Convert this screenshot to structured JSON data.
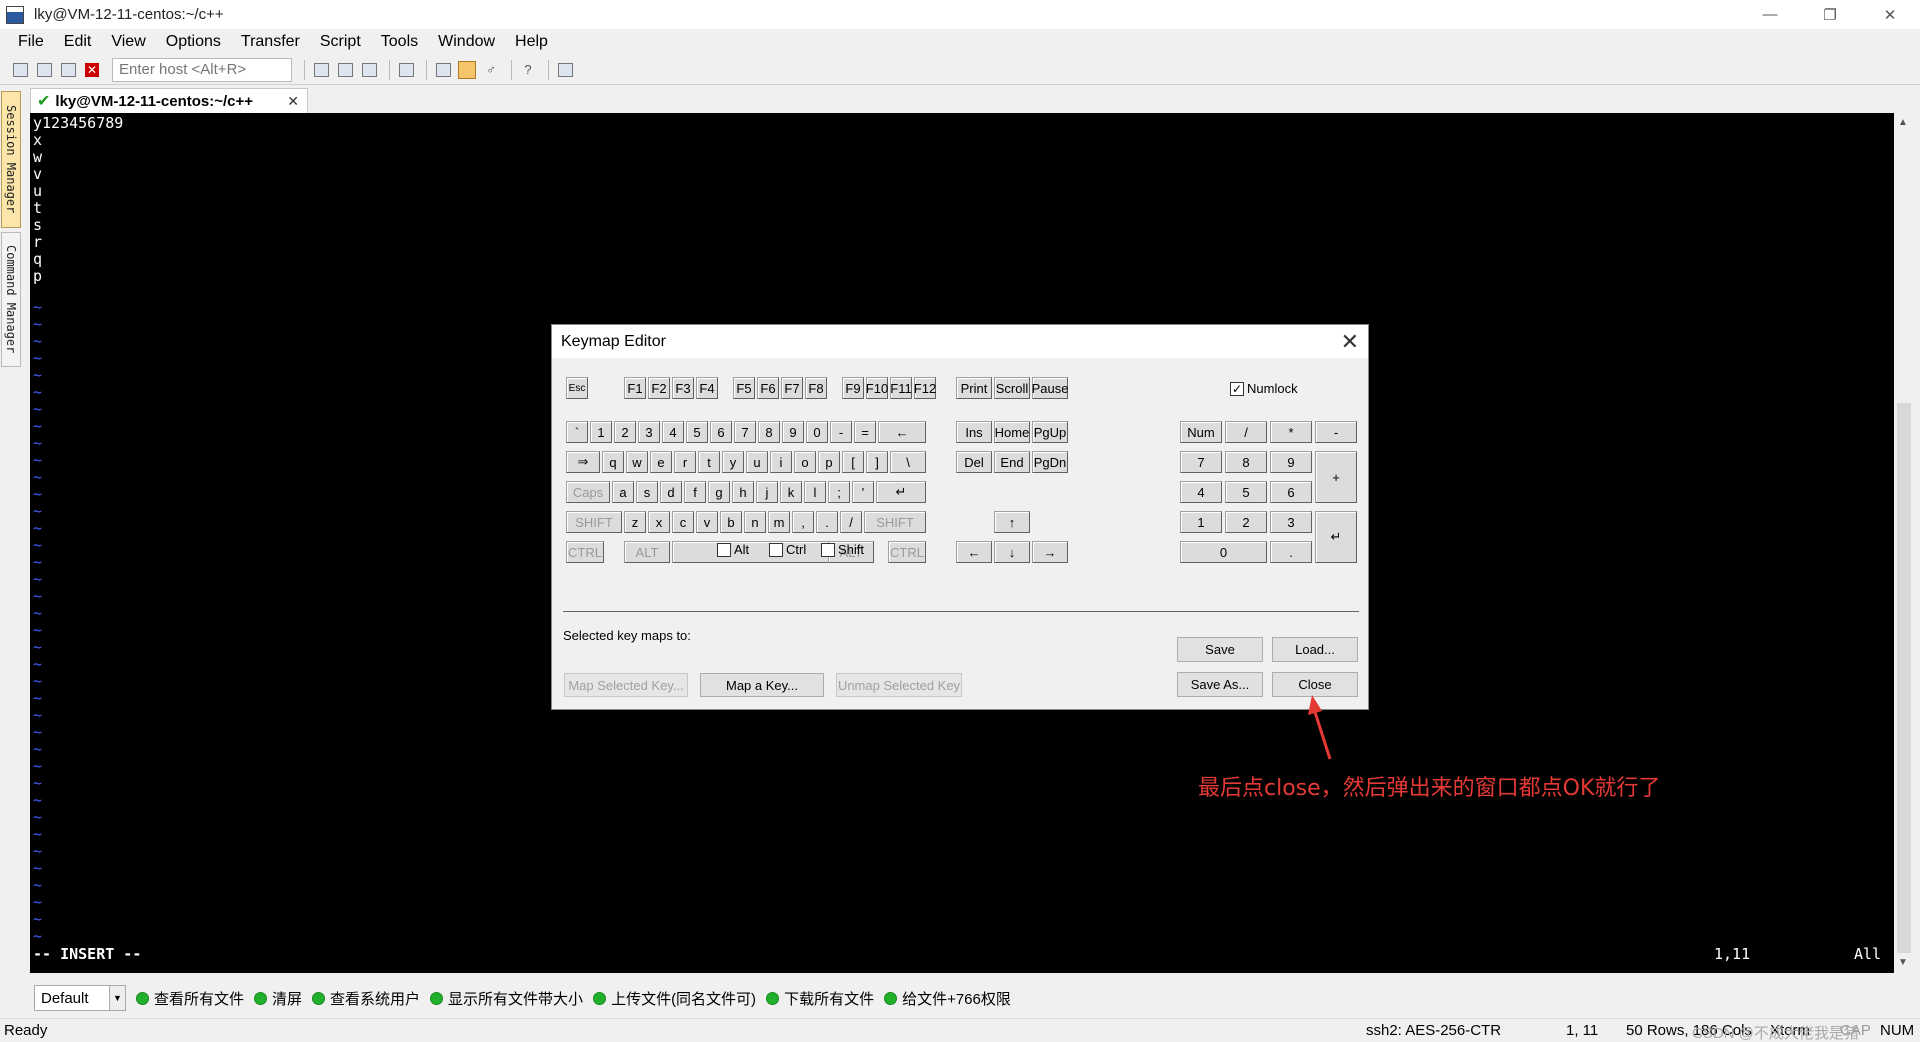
{
  "window": {
    "title": "lky@VM-12-11-centos:~/c++",
    "controls": [
      "—",
      "❐",
      "✕"
    ]
  },
  "menu": [
    "File",
    "Edit",
    "View",
    "Options",
    "Transfer",
    "Script",
    "Tools",
    "Window",
    "Help"
  ],
  "toolbar": {
    "host_placeholder": "Enter host <Alt+R>"
  },
  "side_tabs": {
    "session": "Session Manager",
    "command": "Command Manager"
  },
  "session_tab": {
    "label": "lky@VM-12-11-centos:~/c++",
    "check": "✔",
    "close": "✕"
  },
  "terminal": {
    "lines": "y123456789\nx\nw\nv\nu\nt\ns\nr\nq\np",
    "tilde": "~",
    "mode": "-- INSERT --",
    "position": "1,11",
    "all": "All"
  },
  "dialog": {
    "title": "Keymap Editor",
    "close": "✕",
    "keys": {
      "esc": "Esc",
      "f1": "F1",
      "f2": "F2",
      "f3": "F3",
      "f4": "F4",
      "f5": "F5",
      "f6": "F6",
      "f7": "F7",
      "f8": "F8",
      "f9": "F9",
      "f10": "F10",
      "f11": "F11",
      "f12": "F12",
      "print": "Print",
      "scroll": "Scroll",
      "pause": "Pause",
      "backtick": "`",
      "n1": "1",
      "n2": "2",
      "n3": "3",
      "n4": "4",
      "n5": "5",
      "n6": "6",
      "n7": "7",
      "n8": "8",
      "n9": "9",
      "n0": "0",
      "minus": "-",
      "equal": "=",
      "backspace": "←",
      "tab": "⇒",
      "q": "q",
      "w": "w",
      "e": "e",
      "r": "r",
      "t": "t",
      "y": "y",
      "u": "u",
      "i": "i",
      "o": "o",
      "p": "p",
      "lbracket": "[",
      "rbracket": "]",
      "backslash": "\\",
      "caps": "Caps",
      "a": "a",
      "s": "s",
      "d": "d",
      "f": "f",
      "g": "g",
      "h": "h",
      "j": "j",
      "k": "k",
      "l": "l",
      "semicolon": ";",
      "quote": "'",
      "enter": "↵",
      "shift": "SHIFT",
      "z": "z",
      "x": "x",
      "c": "c",
      "v": "v",
      "b": "b",
      "n": "n",
      "m": "m",
      "comma": ",",
      "period": ".",
      "slash": "/",
      "ctrl": "CTRL",
      "alt": "ALT",
      "ins": "Ins",
      "home": "Home",
      "pgup": "PgUp",
      "del": "Del",
      "end": "End",
      "pgdn": "PgDn",
      "up": "↑",
      "down": "↓",
      "left": "←",
      "right": "→",
      "num": "Num",
      "kp_div": "/",
      "kp_mul": "*",
      "kp_sub": "-",
      "kp_add": "+",
      "kp_enter": "↵",
      "kp7": "7",
      "kp8": "8",
      "kp9": "9",
      "kp4": "4",
      "kp5": "5",
      "kp6": "6",
      "kp1": "1",
      "kp2": "2",
      "kp3": "3",
      "kp0": "0",
      "kp_dot": "."
    },
    "numlock": {
      "label": "Numlock",
      "checked": "✓"
    },
    "modifiers": {
      "alt": "Alt",
      "ctrl": "Ctrl",
      "shift": "Shift"
    },
    "selected_label": "Selected key maps to:",
    "buttons": {
      "map_selected": "Map Selected Key...",
      "map_a_key": "Map a Key...",
      "unmap": "Unmap Selected Key",
      "save": "Save",
      "load": "Load...",
      "save_as": "Save As...",
      "close": "Close"
    }
  },
  "annotation": "最后点close，然后弹出来的窗口都点OK就行了",
  "button_bar": {
    "session": "Default",
    "buttons": [
      "查看所有文件",
      "清屏",
      "查看系统用户",
      "显示所有文件带大小",
      "上传文件(同名文件可)",
      "下载所有文件",
      "给文件+766权限"
    ]
  },
  "status": {
    "ready": "Ready",
    "cipher": "ssh2: AES-256-CTR",
    "cursor": "1, 11",
    "size": "50 Rows, 186 Cols",
    "term": "Xterm",
    "caps": "CAP",
    "num": "NUM",
    "watermark": "CSDN @不成大佬我是猪"
  }
}
